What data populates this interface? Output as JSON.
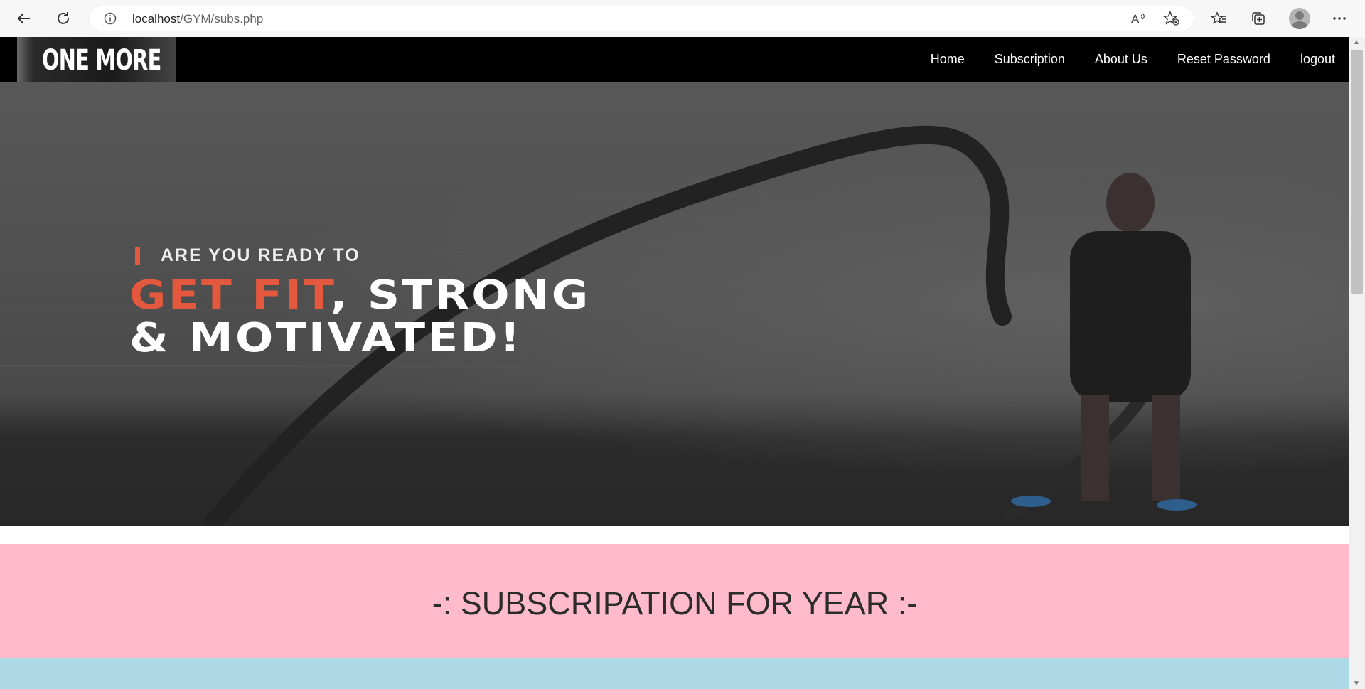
{
  "browser": {
    "url_host": "localhost",
    "url_path": "/GYM/subs.php",
    "icons": [
      "back-arrow-icon",
      "refresh-icon",
      "info-icon",
      "read-aloud-icon",
      "add-favorite-icon",
      "favorites-icon",
      "collections-icon",
      "profile-icon",
      "more-icon"
    ]
  },
  "nav": {
    "brand": "ONE MORE",
    "links": [
      "Home",
      "Subscription",
      "About Us",
      "Reset Password",
      "logout"
    ]
  },
  "hero": {
    "pre": "ARE YOU READY TO",
    "accent": "GET FIT",
    "line1_rest": ", STRONG",
    "line2": "& MOTIVATED!",
    "accent_color": "#e4583e"
  },
  "section": {
    "title": "-: SUBSCRIPATION FOR YEAR :-",
    "bg_color": "#ffbbcb",
    "next_bg_color": "#add8e6"
  }
}
